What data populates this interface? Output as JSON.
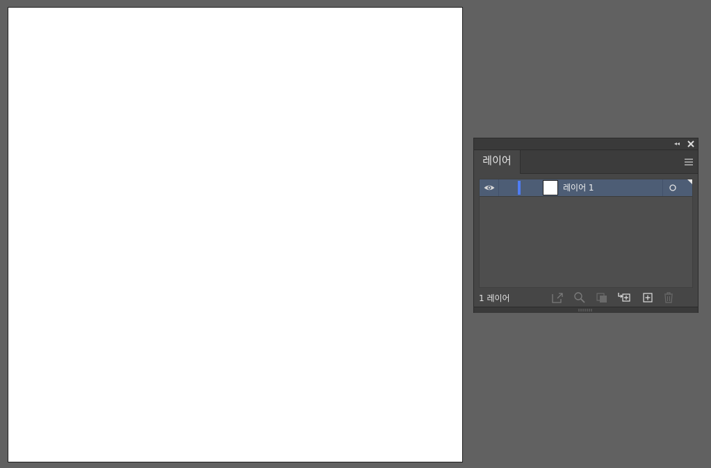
{
  "layers_panel": {
    "tab_label": "레이어",
    "collapse_glyph": "◂◂",
    "layers": [
      {
        "name": "레이어 1",
        "visible": true,
        "selected": true,
        "color": "#4f7df5"
      }
    ],
    "footer_count": "1 레이어",
    "footer_icons": [
      "export-icon",
      "search-icon",
      "clipping-mask-icon",
      "new-sublayer-icon",
      "new-layer-icon",
      "trash-icon"
    ]
  },
  "colors": {
    "workspace_bg": "#616161",
    "artboard": "#ffffff",
    "panel_bg": "#464646",
    "selected_row": "#4d5d75",
    "layer_color": "#4f7df5"
  }
}
